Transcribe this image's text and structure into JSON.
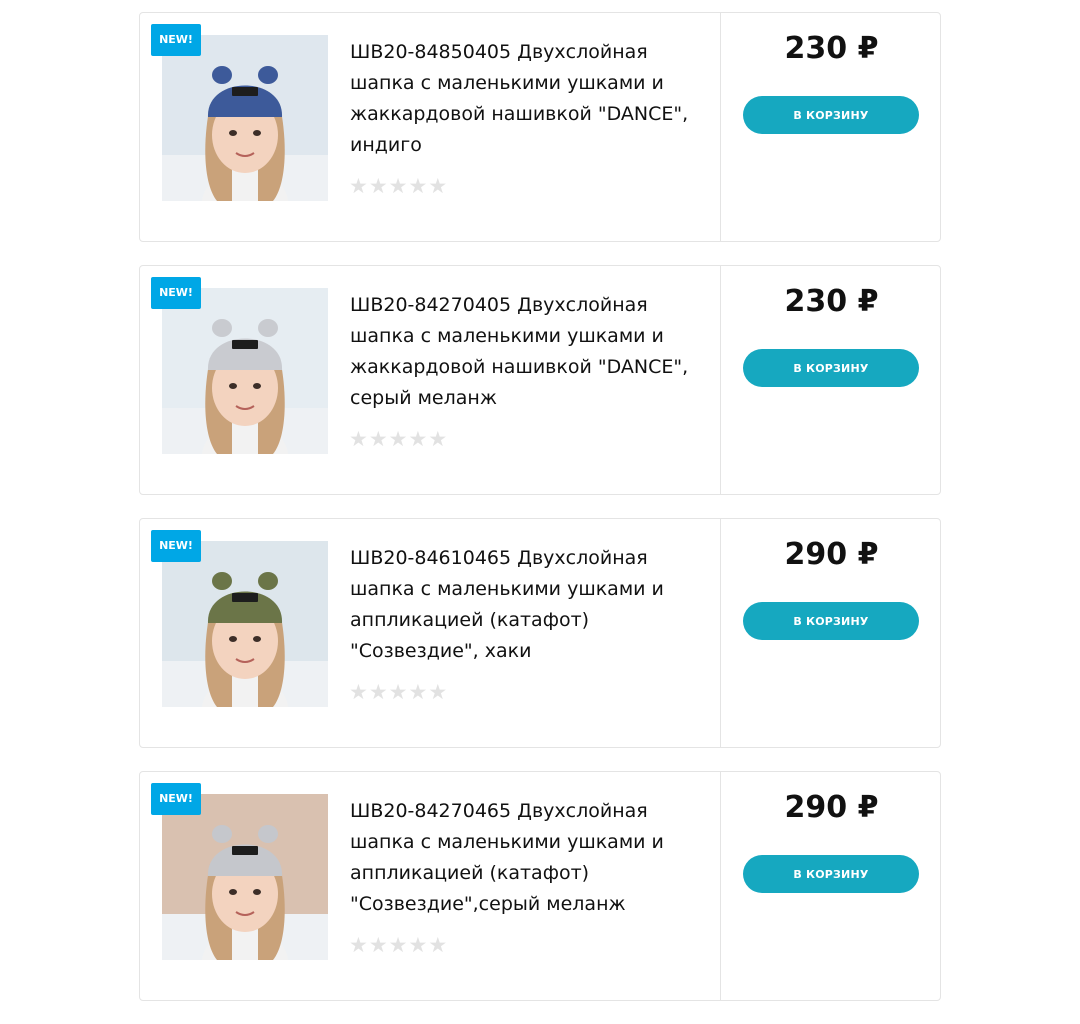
{
  "products": [
    {
      "badge": "NEW!",
      "title": "ШВ20-84850405 Двухслойная шапка с маленькими ушками и жаккардовой нашивкой \"DANCE\", индиго",
      "price": "230 ₽",
      "button": "В КОРЗИНУ",
      "rating": 0,
      "hat_color": "#3d5a9a",
      "bg_color": "#dfe7ee",
      "hat_label": "DANCE",
      "alt_icon": "child-photo-icon"
    },
    {
      "badge": "NEW!",
      "title": "ШВ20-84270405 Двухслойная шапка с маленькими ушками и жаккардовой нашивкой \"DANCE\", серый меланж",
      "price": "230 ₽",
      "button": "В КОРЗИНУ",
      "rating": 0,
      "hat_color": "#c9cbd0",
      "bg_color": "#e6edf2",
      "hat_label": "DANCE",
      "alt_icon": "child-photo-icon"
    },
    {
      "badge": "NEW!",
      "title": "ШВ20-84610465 Двухслойная шапка с маленькими ушками и аппликацией (катафот) \"Созвездие\", хаки",
      "price": "290 ₽",
      "button": "В КОРЗИНУ",
      "rating": 0,
      "hat_color": "#6b7548",
      "bg_color": "#dde6ec",
      "hat_label": "",
      "alt_icon": "child-photo-icon"
    },
    {
      "badge": "NEW!",
      "title": "ШВ20-84270465 Двухслойная шапка с маленькими ушками и аппликацией (катафот) \"Созвездие\",серый меланж",
      "price": "290 ₽",
      "button": "В КОРЗИНУ",
      "rating": 0,
      "hat_color": "#c5c7cc",
      "bg_color": "#d9c1b0",
      "hat_label": "",
      "alt_icon": "child-photo-icon"
    }
  ],
  "colors": {
    "badge": "#00a7e6",
    "button": "#16a8c0",
    "star_empty": "#e2e2e2",
    "border": "#e4e4e4"
  }
}
